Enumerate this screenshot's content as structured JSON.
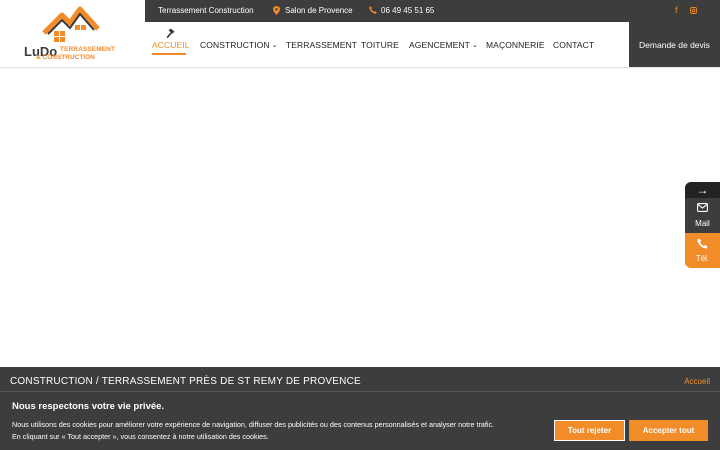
{
  "logo": {
    "brand": "LuDo",
    "line1": "TERRASSEMENT",
    "line2": "& CONSTRUCTION"
  },
  "topbar": {
    "tagline": "Terrassement Construction",
    "location": "Salon de Provence",
    "phone": "06 49 45 51 65",
    "social": [
      "facebook-icon",
      "instagram-icon"
    ]
  },
  "nav": {
    "items": [
      {
        "label": "ACCUEIL",
        "active": true
      },
      {
        "label": "CONSTRUCTION",
        "dropdown": true
      },
      {
        "label": "TERRASSEMENT"
      },
      {
        "label": "TOITURE"
      },
      {
        "label": "AGENCEMENT",
        "dropdown": true
      },
      {
        "label": "MAÇONNERIE"
      },
      {
        "label": "CONTACT"
      }
    ],
    "cta": "Demande de devis"
  },
  "side": {
    "mail": "Mail",
    "tel": "Tél."
  },
  "banner": {
    "title": "CONSTRUCTION / TERRASSEMENT PRÈS DE ST REMY DE PROVENCE",
    "breadcrumb": "Accueil"
  },
  "cookie": {
    "title": "Nous respectons votre vie privée.",
    "line1": "Nous utilisons des cookies pour améliorer votre expérience de navigation, diffuser des publicités ou des contenus personnalisés et analyser notre trafic.",
    "line2": "En cliquant sur « Tout accepter », vous consentez à notre utilisation des cookies.",
    "reject": "Tout rejeter",
    "accept": "Accepter tout"
  },
  "colors": {
    "accent": "#f28c28",
    "dark": "#3d3d3d"
  }
}
